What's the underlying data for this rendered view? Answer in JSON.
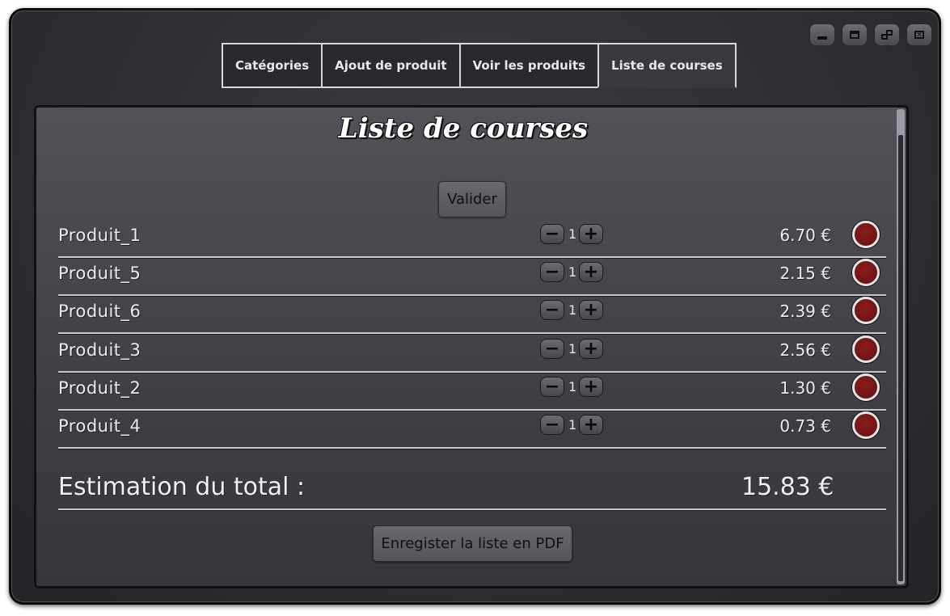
{
  "window": {
    "controls": {
      "minimize": "minimize-icon",
      "maximize": "maximize-icon",
      "restore": "restore-icon",
      "close": "close-icon"
    }
  },
  "tabs": [
    {
      "label": "Catégories",
      "active": false
    },
    {
      "label": "Ajout de produit",
      "active": false
    },
    {
      "label": "Voir les produits",
      "active": false
    },
    {
      "label": "Liste de courses",
      "active": true
    }
  ],
  "main": {
    "title": "Liste de courses",
    "validate_label": "Valider",
    "items": [
      {
        "name": "Produit_1",
        "quantity": "1",
        "price": "6.70 €"
      },
      {
        "name": "Produit_5",
        "quantity": "1",
        "price": "2.15 €"
      },
      {
        "name": "Produit_6",
        "quantity": "1",
        "price": "2.39 €"
      },
      {
        "name": "Produit_3",
        "quantity": "1",
        "price": "2.56 €"
      },
      {
        "name": "Produit_2",
        "quantity": "1",
        "price": "1.30 €"
      },
      {
        "name": "Produit_4",
        "quantity": "1",
        "price": "0.73 €"
      }
    ],
    "minus_symbol": "−",
    "plus_symbol": "+",
    "total_label": "Estimation du total :",
    "total_value": "15.83 €",
    "pdf_label": "Enregister la liste en PDF"
  },
  "colors": {
    "background": "#3a393e",
    "delete_button": "#7a1818",
    "text": "#ececee"
  }
}
